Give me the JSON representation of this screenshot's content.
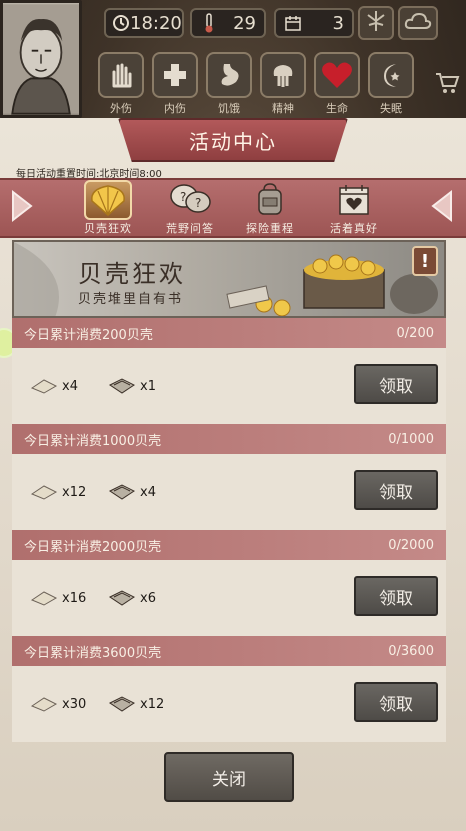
{
  "hud": {
    "time": "18:20",
    "temperature": "29",
    "day": "3"
  },
  "statuses": [
    {
      "label": "外伤",
      "icon": "hand-icon"
    },
    {
      "label": "内伤",
      "icon": "cross-icon"
    },
    {
      "label": "饥饿",
      "icon": "stomach-icon"
    },
    {
      "label": "精神",
      "icon": "brain-icon"
    },
    {
      "label": "生命",
      "icon": "heart-icon"
    },
    {
      "label": "失眠",
      "icon": "moon-icon"
    }
  ],
  "panel": {
    "title": "活动中心",
    "reset_note": "每日活动重置时间:北京时间8:00"
  },
  "tabs": [
    {
      "label": "贝壳狂欢",
      "icon": "shell-icon",
      "active": true
    },
    {
      "label": "荒野问答",
      "icon": "question-icon",
      "active": false
    },
    {
      "label": "探险重程",
      "icon": "backpack-icon",
      "active": false
    },
    {
      "label": "活着真好",
      "icon": "calendar-heart-icon",
      "active": false
    }
  ],
  "banner": {
    "title": "贝壳狂欢",
    "subtitle": "贝壳堆里自有书",
    "info": "!"
  },
  "rewards": [
    {
      "title": "今日累计消费200贝壳",
      "progress": "0/200",
      "item1": "x4",
      "item2": "x1",
      "button": "领取"
    },
    {
      "title": "今日累计消费1000贝壳",
      "progress": "0/1000",
      "item1": "x12",
      "item2": "x4",
      "button": "领取"
    },
    {
      "title": "今日累计消费2000贝壳",
      "progress": "0/2000",
      "item1": "x16",
      "item2": "x6",
      "button": "领取"
    },
    {
      "title": "今日累计消费3600贝壳",
      "progress": "0/3600",
      "item1": "x30",
      "item2": "x12",
      "button": "领取"
    }
  ],
  "close_label": "关闭",
  "colors": {
    "accent_red": "#9d5554",
    "parchment": "#e8e0d3",
    "button_gray": "#5c5954"
  }
}
